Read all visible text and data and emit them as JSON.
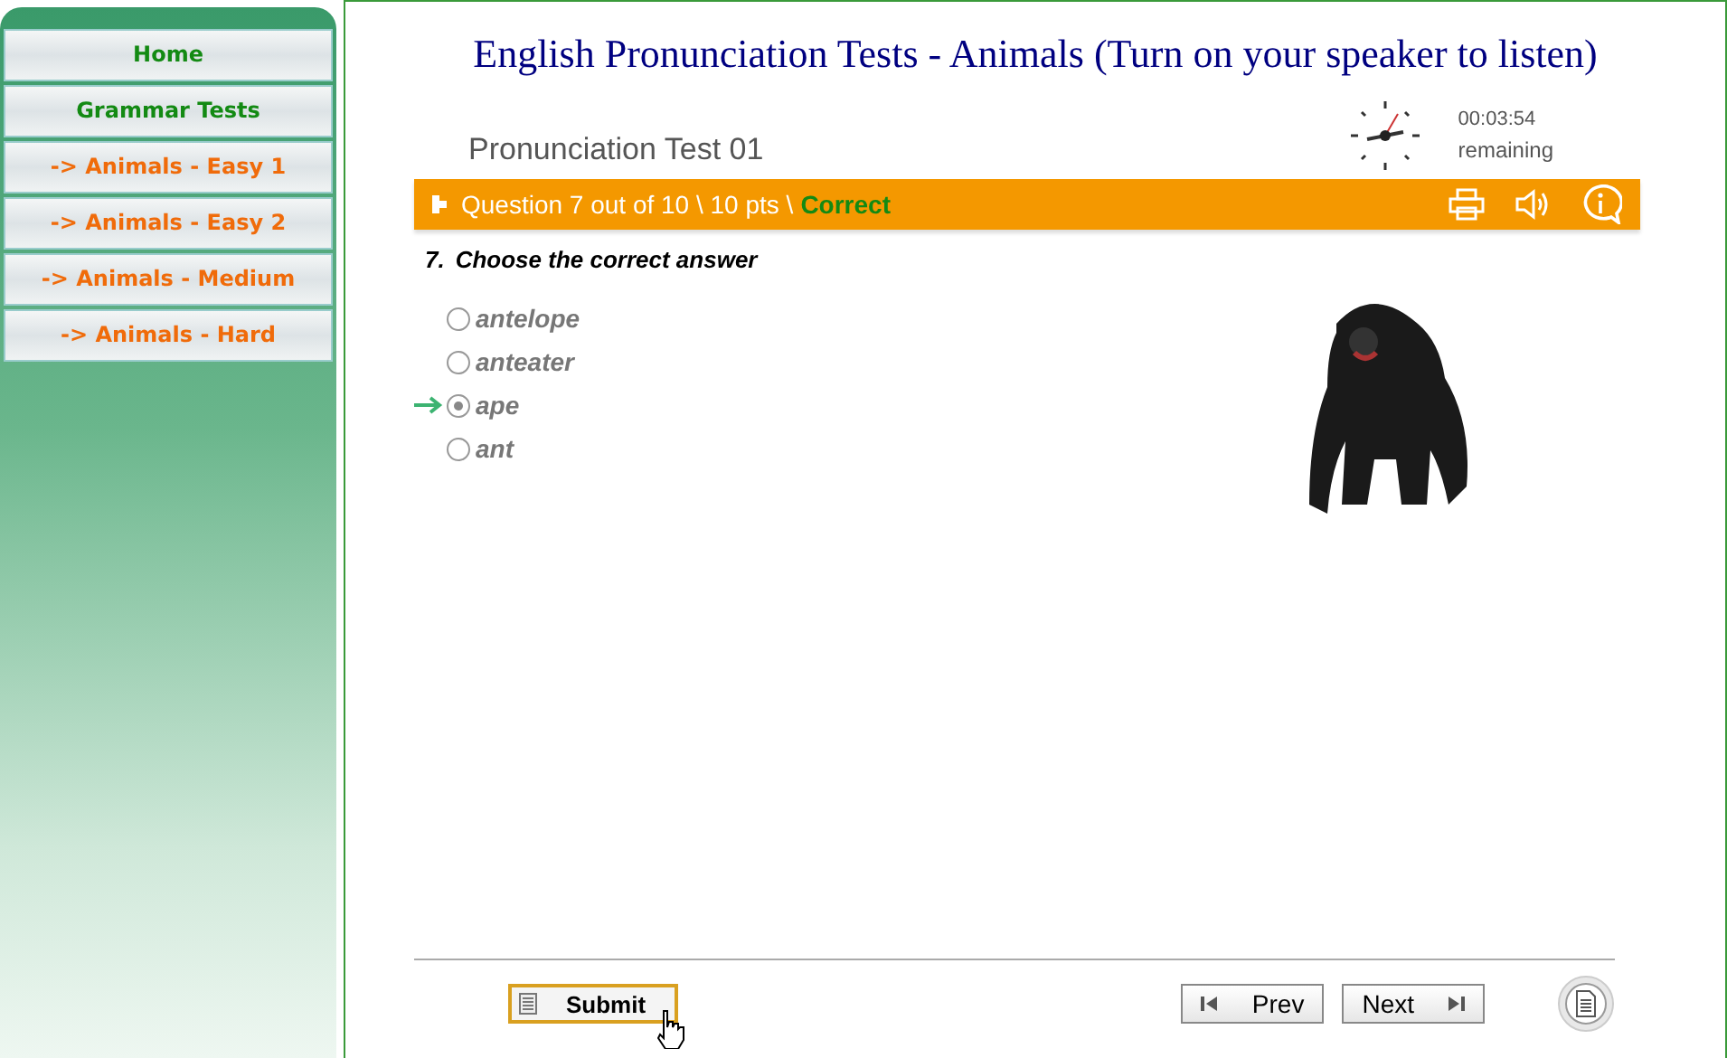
{
  "sidebar": {
    "items": [
      {
        "label": "Home",
        "kind": "section"
      },
      {
        "label": "Grammar Tests",
        "kind": "section"
      },
      {
        "label": "-> Animals - Easy 1",
        "kind": "link"
      },
      {
        "label": "-> Animals - Easy 2",
        "kind": "link"
      },
      {
        "label": "-> Animals - Medium",
        "kind": "link"
      },
      {
        "label": "-> Animals - Hard",
        "kind": "link"
      }
    ]
  },
  "page_title": "English Pronunciation Tests - Animals (Turn on your speaker to listen)",
  "test": {
    "title": "Pronunciation Test 01",
    "timer": "00:03:54",
    "timer_label": "remaining"
  },
  "question_bar": {
    "text": "Question 7 out of 10 \\ 10 pts \\",
    "result": "Correct"
  },
  "question": {
    "number": "7.",
    "prompt": "Choose the correct answer",
    "options": [
      {
        "label": "antelope",
        "selected": false
      },
      {
        "label": "anteater",
        "selected": false
      },
      {
        "label": "ape",
        "selected": true
      },
      {
        "label": "ant",
        "selected": false
      }
    ]
  },
  "buttons": {
    "submit": "Submit",
    "prev": "Prev",
    "next": "Next"
  }
}
